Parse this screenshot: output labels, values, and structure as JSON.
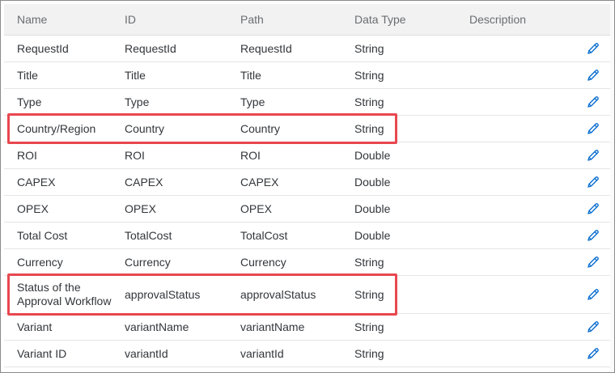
{
  "table": {
    "columns": {
      "name": "Name",
      "id": "ID",
      "path": "Path",
      "data_type": "Data Type",
      "description": "Description"
    },
    "rows": [
      {
        "name": "RequestId",
        "id": "RequestId",
        "path": "RequestId",
        "data_type": "String",
        "description": "",
        "highlighted": false
      },
      {
        "name": "Title",
        "id": "Title",
        "path": "Title",
        "data_type": "String",
        "description": "",
        "highlighted": false
      },
      {
        "name": "Type",
        "id": "Type",
        "path": "Type",
        "data_type": "String",
        "description": "",
        "highlighted": false
      },
      {
        "name": "Country/Region",
        "id": "Country",
        "path": "Country",
        "data_type": "String",
        "description": "",
        "highlighted": true
      },
      {
        "name": "ROI",
        "id": "ROI",
        "path": "ROI",
        "data_type": "Double",
        "description": "",
        "highlighted": false
      },
      {
        "name": "CAPEX",
        "id": "CAPEX",
        "path": "CAPEX",
        "data_type": "Double",
        "description": "",
        "highlighted": false
      },
      {
        "name": "OPEX",
        "id": "OPEX",
        "path": "OPEX",
        "data_type": "Double",
        "description": "",
        "highlighted": false
      },
      {
        "name": "Total Cost",
        "id": "TotalCost",
        "path": "TotalCost",
        "data_type": "Double",
        "description": "",
        "highlighted": false
      },
      {
        "name": "Currency",
        "id": "Currency",
        "path": "Currency",
        "data_type": "String",
        "description": "",
        "highlighted": false
      },
      {
        "name": "Status of the\nApproval Workflow",
        "id": "approvalStatus",
        "path": "approvalStatus",
        "data_type": "String",
        "description": "",
        "highlighted": true
      },
      {
        "name": "Variant",
        "id": "variantName",
        "path": "variantName",
        "data_type": "String",
        "description": "",
        "highlighted": false
      },
      {
        "name": "Variant ID",
        "id": "variantId",
        "path": "variantId",
        "data_type": "String",
        "description": "",
        "highlighted": false
      }
    ],
    "row_action_icon": "edit-pencil-icon"
  },
  "colors": {
    "highlight_border": "#e8474f",
    "icon_blue": "#0a6ed1",
    "header_bg": "#f2f2f2"
  }
}
